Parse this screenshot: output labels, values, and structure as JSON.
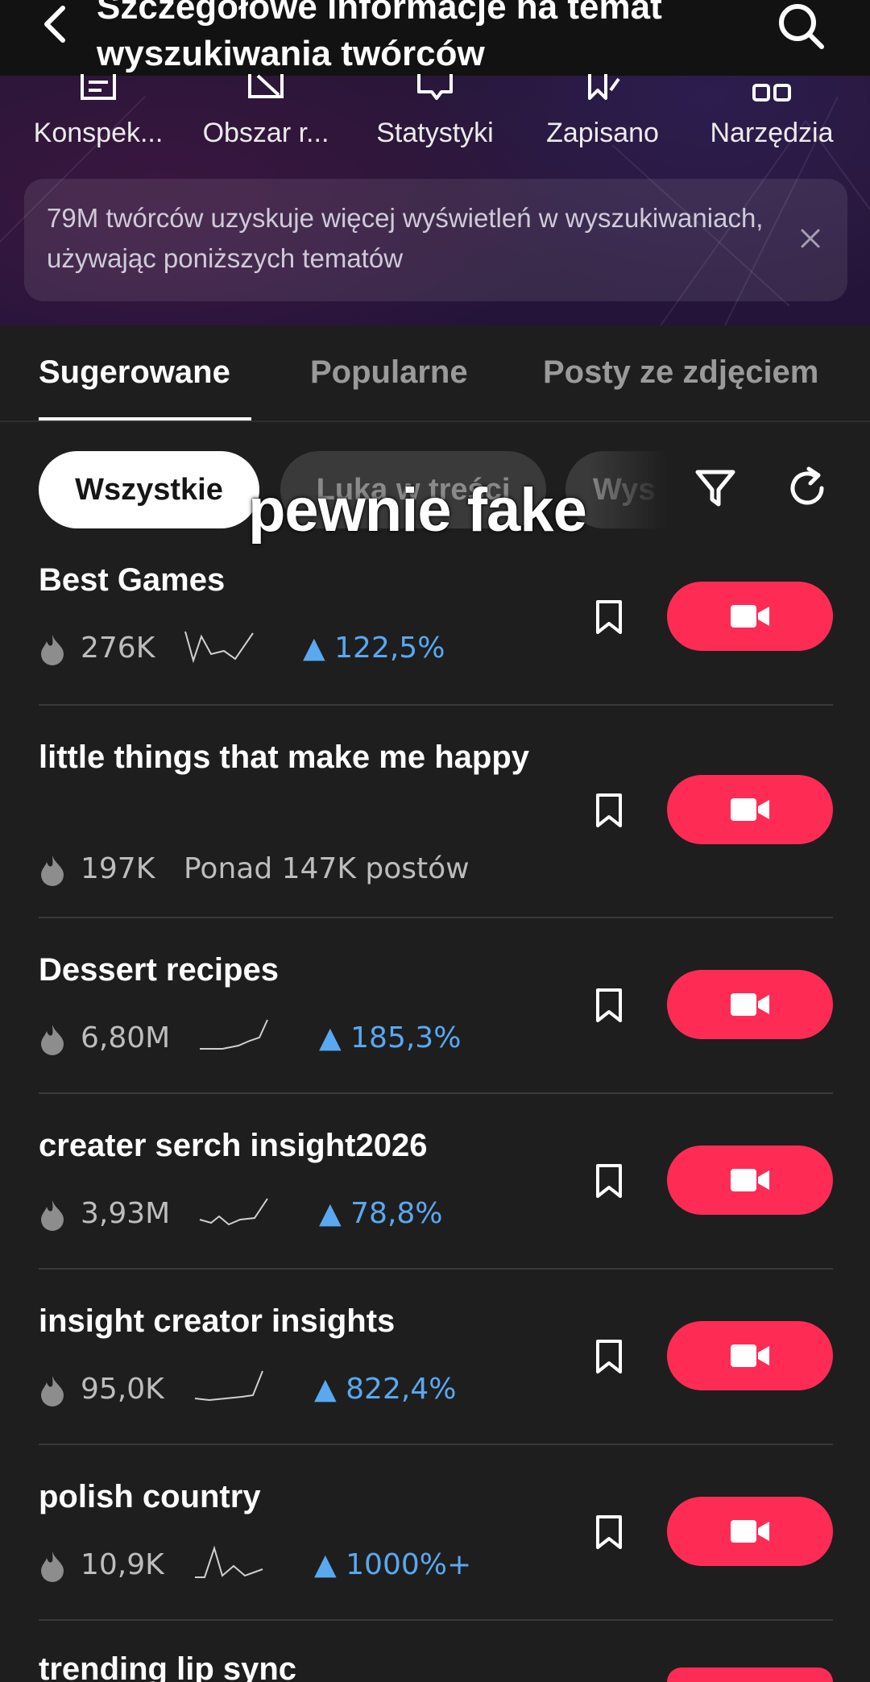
{
  "header": {
    "title_line1": "Szczegółowe informacje na temat",
    "title_line2": "wyszukiwania twórców"
  },
  "tools": [
    {
      "label": "Konspek...",
      "icon": "outline-icon"
    },
    {
      "label": "Obszar r...",
      "icon": "content-gap-icon"
    },
    {
      "label": "Statystyki",
      "icon": "statistics-icon"
    },
    {
      "label": "Zapisano",
      "icon": "saved-icon"
    },
    {
      "label": "Narzędzia",
      "icon": "tools-icon"
    }
  ],
  "banner": {
    "text": "79M twórców uzyskuje więcej wyświetleń w wyszukiwaniach, używając poniższych tematów"
  },
  "tabs": [
    "Sugerowane",
    "Popularne",
    "Posty ze zdjęciem"
  ],
  "chips": [
    "Wszystkie",
    "Luka w treści",
    "Wys"
  ],
  "overlay_text": "pewnie fake",
  "items": [
    {
      "title": "Best Games",
      "views": "276K",
      "growth": "122,5%"
    },
    {
      "title": "little things that make me happy",
      "views": "197K",
      "posts": "Ponad 147K postów"
    },
    {
      "title": "Dessert recipes",
      "views": "6,80M",
      "growth": "185,3%"
    },
    {
      "title": "creater serch insight2026",
      "views": "3,93M",
      "growth": "78,8%"
    },
    {
      "title": "insight creator insights",
      "views": "95,0K",
      "growth": "822,4%"
    },
    {
      "title": "polish country",
      "views": "10,9K",
      "growth": "1000%+"
    },
    {
      "title": "trending lip sync"
    }
  ],
  "colors": {
    "accent": "#fe2c55",
    "growth": "#5aa8f0",
    "background": "#1e1e1e"
  }
}
